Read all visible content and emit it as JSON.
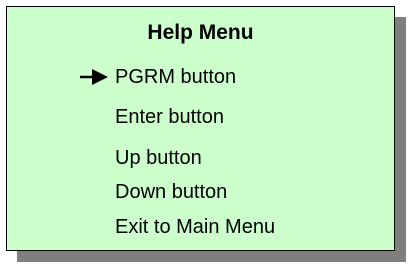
{
  "menu": {
    "title": "Help Menu",
    "selected_index": 0,
    "pointer_icon": "arrow-right-icon",
    "items": [
      {
        "label": "PGRM button"
      },
      {
        "label": "Enter button"
      },
      {
        "label": "Up button"
      },
      {
        "label": "Down button"
      },
      {
        "label": "Exit to Main Menu"
      }
    ]
  },
  "colors": {
    "panel_background": "#ccffcc",
    "panel_border": "#000000",
    "shadow": "#7f7f7f",
    "text": "#000000"
  }
}
